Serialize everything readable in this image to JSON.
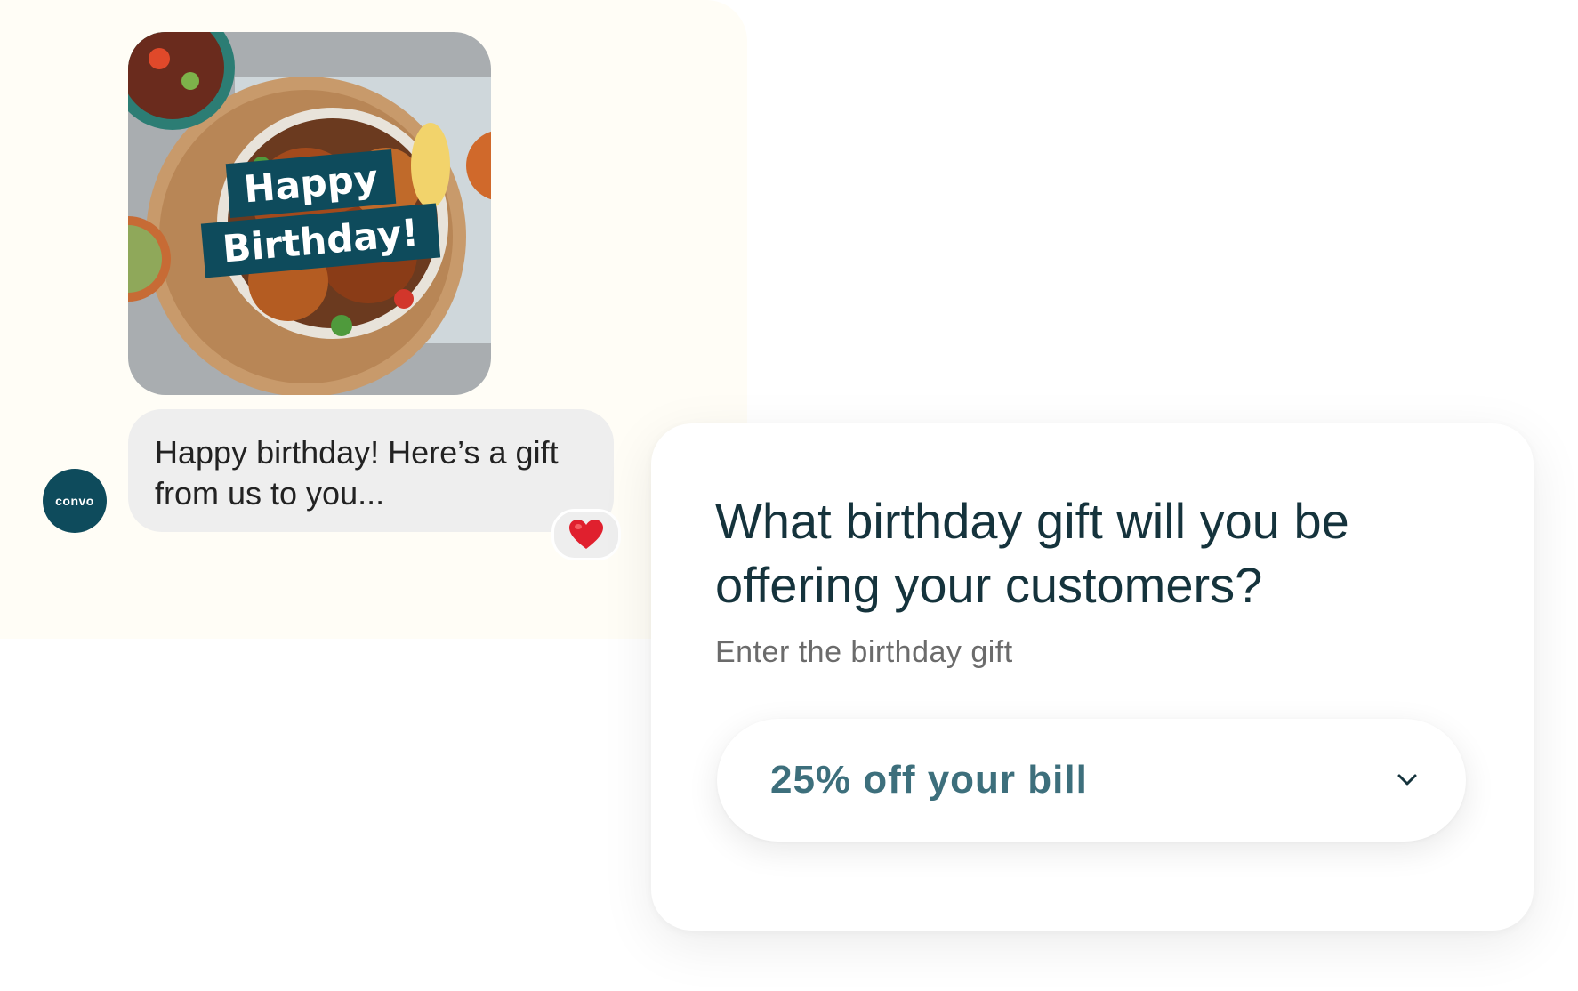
{
  "chat": {
    "image_banner_line1": "Happy",
    "image_banner_line2": "Birthday!",
    "avatar_logo": "convo",
    "message_line1": "Happy birthday! Here’s a gift",
    "message_line2": "from us to you...",
    "reaction_icon": "heart-icon"
  },
  "form": {
    "question_line1": "What birthday gift will you be",
    "question_line2": "offering your customers?",
    "hint": "Enter the birthday gift",
    "selected_gift": "25% off your bill"
  },
  "colors": {
    "brand_teal": "#0e4b5c",
    "select_text": "#3d6f7c",
    "chat_panel_bg": "#fffdf6",
    "heart": "#e0202e"
  }
}
